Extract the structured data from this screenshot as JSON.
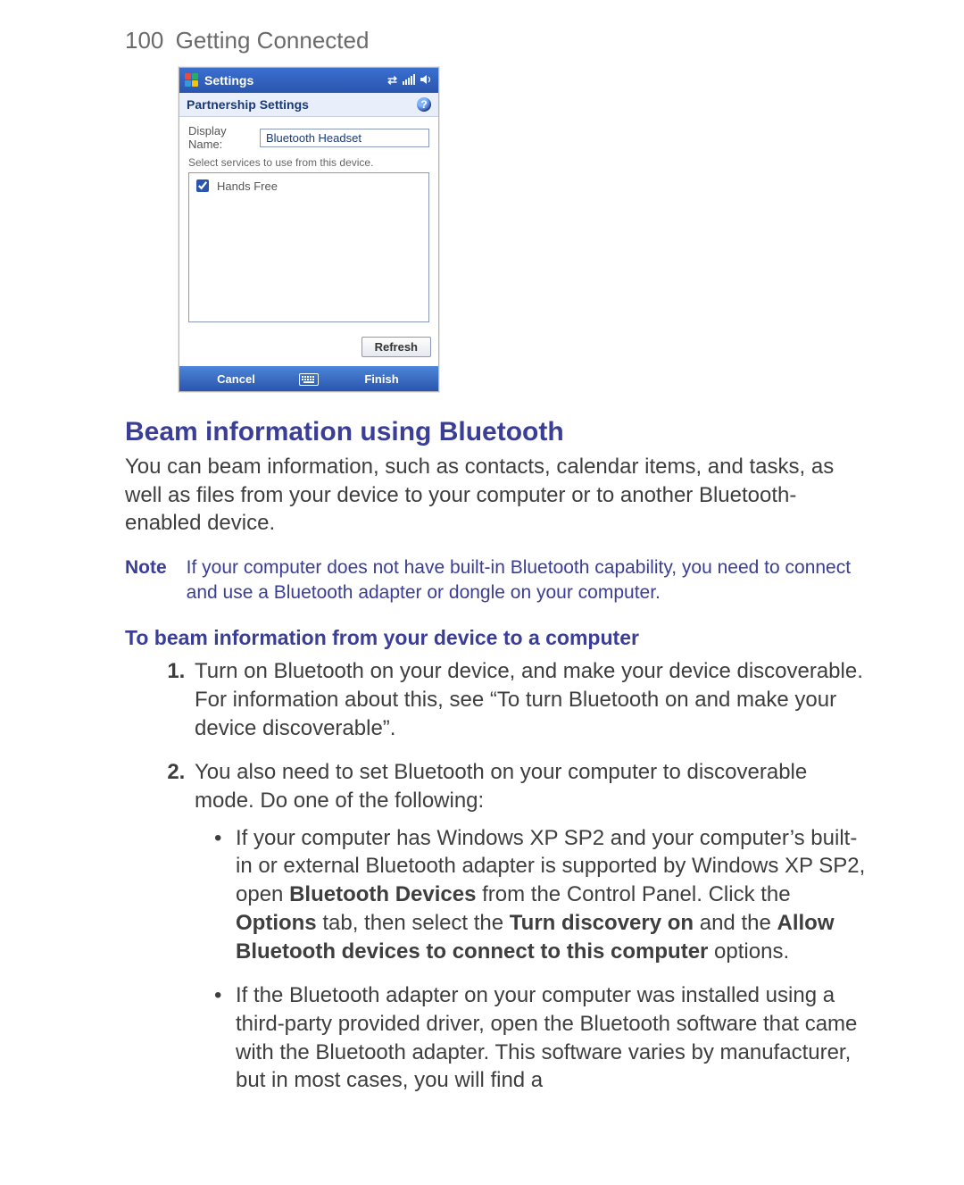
{
  "page": {
    "number": "100",
    "chapter": "Getting Connected"
  },
  "screenshot": {
    "titlebar": {
      "title": "Settings"
    },
    "subtitle": "Partnership Settings",
    "help_glyph": "?",
    "display_name_label": "Display Name:",
    "display_name_value": "Bluetooth Headset",
    "hint": "Select services to use from this device.",
    "services": [
      {
        "label": "Hands Free",
        "checked": true
      }
    ],
    "refresh_label": "Refresh",
    "bottom": {
      "left": "Cancel",
      "right": "Finish"
    }
  },
  "section": {
    "heading": "Beam information using Bluetooth",
    "intro": "You can beam information, such as contacts, calendar items, and tasks, as well as files from your device to your computer or to another Bluetooth-enabled device."
  },
  "note": {
    "label": "Note",
    "text": "If your computer does not have built-in Bluetooth capability, you need to connect and use a Bluetooth adapter or dongle on your computer."
  },
  "subsection": "To beam information from your device to a computer",
  "steps": {
    "s1": "Turn on Bluetooth on your device, and make your device discoverable. For information about this, see “To turn Bluetooth on and make your device discoverable”.",
    "s2": "You also need to set Bluetooth on your computer to discoverable mode. Do one of the following:",
    "s2a": {
      "pre": "If your computer has Windows XP SP2 and your computer’s built-in or external Bluetooth adapter is supported by Windows XP SP2, open ",
      "b1": "Bluetooth Devices",
      "mid1": " from the Control Panel. Click the ",
      "b2": "Options",
      "mid2": " tab, then select the ",
      "b3": "Turn discovery on",
      "mid3": " and the ",
      "b4": "Allow Bluetooth devices to connect to this computer",
      "post": " options."
    },
    "s2b": "If the Bluetooth adapter on your computer was installed using a third-party provided driver, open the Bluetooth software that came with the Bluetooth adapter. This software varies by manufacturer, but in most cases, you will find a"
  }
}
